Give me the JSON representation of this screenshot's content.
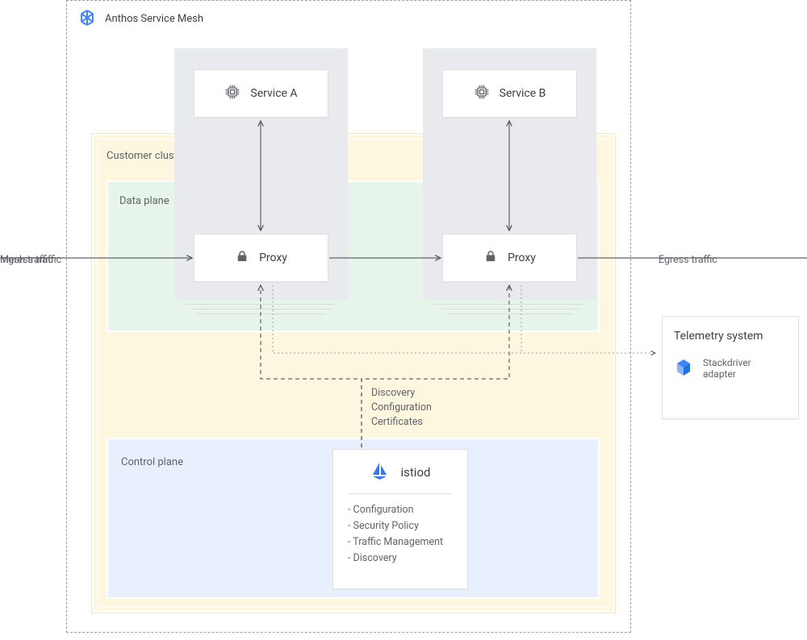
{
  "header": {
    "product_name": "Anthos Service Mesh"
  },
  "cluster": {
    "label": "Customer cluster"
  },
  "data_plane": {
    "label": "Data plane"
  },
  "control_plane": {
    "label": "Control plane"
  },
  "services": {
    "a": {
      "label": "Service A"
    },
    "b": {
      "label": "Service B"
    },
    "proxy_label": "Proxy"
  },
  "traffic": {
    "ingress": "Ingress traffic",
    "mesh": "Mesh traffic",
    "egress": "Egress traffic"
  },
  "pipe_labels": {
    "line1": "Discovery",
    "line2": "Configuration",
    "line3": "Certificates"
  },
  "istiod": {
    "title": "istiod",
    "items": [
      "- Configuration",
      "- Security Policy",
      "- Traffic Management",
      "- Discovery"
    ]
  },
  "telemetry": {
    "title": "Telemetry system",
    "item_label_1": "Stackdriver",
    "item_label_2": "adapter"
  },
  "icons": {
    "mesh_logo": "mesh-logo-icon",
    "cpu": "cpu-chip-icon",
    "lock": "lock-icon",
    "sail": "istio-sail-icon",
    "stackdriver": "stackdriver-hex-icon"
  }
}
